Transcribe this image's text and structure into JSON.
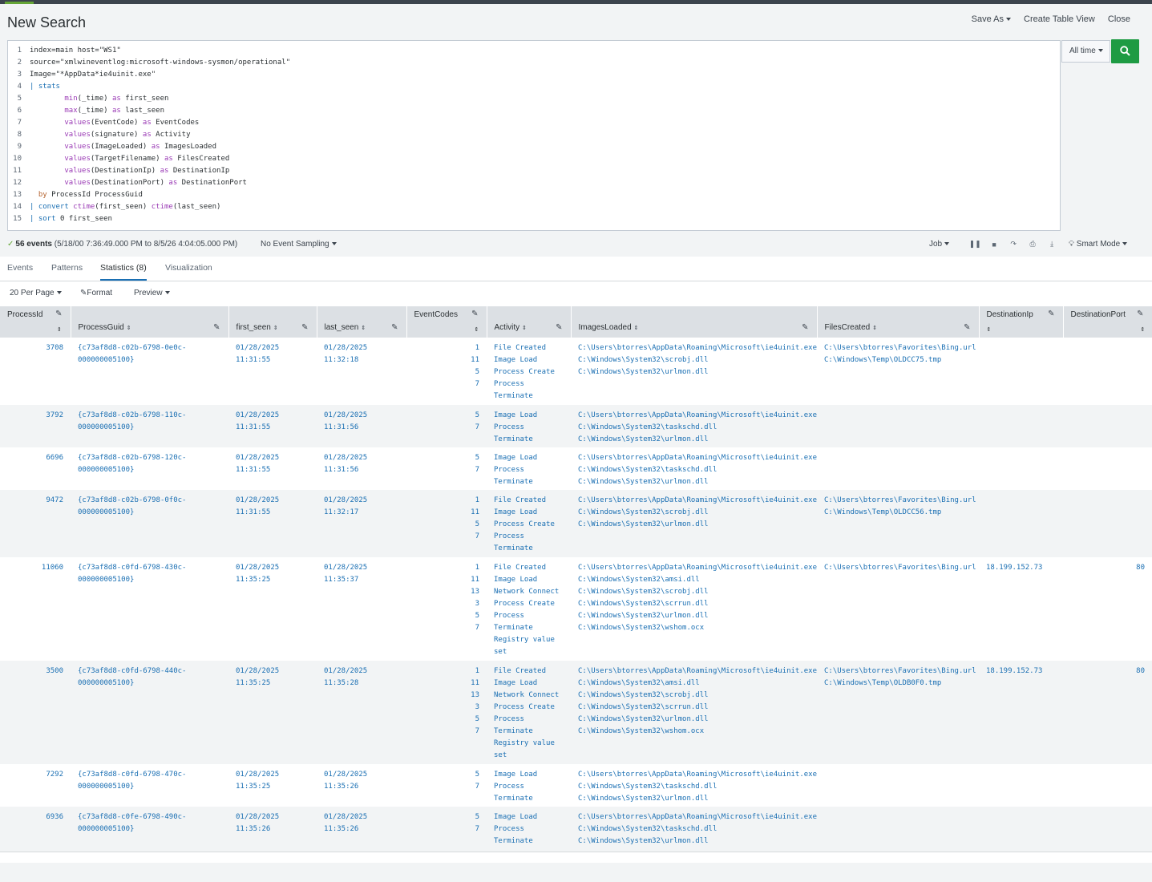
{
  "header": {
    "title": "New Search",
    "save_as": "Save As",
    "create_table_view": "Create Table View",
    "close": "Close"
  },
  "editor": {
    "lines": [
      {
        "n": "1",
        "parts": [
          [
            "",
            "index=main host=\"WS1\""
          ]
        ]
      },
      {
        "n": "2",
        "parts": [
          [
            "",
            "source=\"xmlwineventlog:microsoft-windows-sysmon/operational\""
          ]
        ]
      },
      {
        "n": "3",
        "parts": [
          [
            "",
            "Image=\"*AppData*ie4uinit.exe\""
          ]
        ]
      },
      {
        "n": "4",
        "parts": [
          [
            "pipe",
            "| "
          ],
          [
            "cmd",
            "stats"
          ]
        ]
      },
      {
        "n": "5",
        "parts": [
          [
            "",
            "        "
          ],
          [
            "kw",
            "min"
          ],
          [
            "",
            "(_time) "
          ],
          [
            "kw",
            "as"
          ],
          [
            "",
            " first_seen"
          ]
        ]
      },
      {
        "n": "6",
        "parts": [
          [
            "",
            "        "
          ],
          [
            "kw",
            "max"
          ],
          [
            "",
            "(_time) "
          ],
          [
            "kw",
            "as"
          ],
          [
            "",
            " last_seen"
          ]
        ]
      },
      {
        "n": "7",
        "parts": [
          [
            "",
            "        "
          ],
          [
            "kw",
            "values"
          ],
          [
            "",
            "(EventCode) "
          ],
          [
            "kw",
            "as"
          ],
          [
            "",
            " EventCodes"
          ]
        ]
      },
      {
        "n": "8",
        "parts": [
          [
            "",
            "        "
          ],
          [
            "kw",
            "values"
          ],
          [
            "",
            "(signature) "
          ],
          [
            "kw",
            "as"
          ],
          [
            "",
            " Activity"
          ]
        ]
      },
      {
        "n": "9",
        "parts": [
          [
            "",
            "        "
          ],
          [
            "kw",
            "values"
          ],
          [
            "",
            "(ImageLoaded) "
          ],
          [
            "kw",
            "as"
          ],
          [
            "",
            " ImagesLoaded"
          ]
        ]
      },
      {
        "n": "10",
        "parts": [
          [
            "",
            "        "
          ],
          [
            "kw",
            "values"
          ],
          [
            "",
            "(TargetFilename) "
          ],
          [
            "kw",
            "as"
          ],
          [
            "",
            " FilesCreated"
          ]
        ]
      },
      {
        "n": "11",
        "parts": [
          [
            "",
            "        "
          ],
          [
            "kw",
            "values"
          ],
          [
            "",
            "(DestinationIp) "
          ],
          [
            "kw",
            "as"
          ],
          [
            "",
            " DestinationIp"
          ]
        ]
      },
      {
        "n": "12",
        "parts": [
          [
            "",
            "        "
          ],
          [
            "kw",
            "values"
          ],
          [
            "",
            "(DestinationPort) "
          ],
          [
            "kw",
            "as"
          ],
          [
            "",
            " DestinationPort"
          ]
        ]
      },
      {
        "n": "13",
        "parts": [
          [
            "",
            "  "
          ],
          [
            "by",
            "by"
          ],
          [
            "",
            " ProcessId ProcessGuid"
          ]
        ]
      },
      {
        "n": "14",
        "parts": [
          [
            "pipe",
            "| "
          ],
          [
            "cmd",
            "convert"
          ],
          [
            "",
            " "
          ],
          [
            "kw",
            "ctime"
          ],
          [
            "",
            "(first_seen) "
          ],
          [
            "kw",
            "ctime"
          ],
          [
            "",
            "(last_seen)"
          ]
        ]
      },
      {
        "n": "15",
        "parts": [
          [
            "pipe",
            "| "
          ],
          [
            "cmd",
            "sort"
          ],
          [
            "",
            " 0 first_seen"
          ]
        ]
      }
    ]
  },
  "time_picker": "All time",
  "status": {
    "events_count": "56 events",
    "range": "(5/18/00 7:36:49.000 PM to 8/5/26 4:04:05.000 PM)",
    "sampling": "No Event Sampling",
    "job": "Job",
    "mode": "Smart Mode"
  },
  "tabs": [
    "Events",
    "Patterns",
    "Statistics (8)",
    "Visualization"
  ],
  "table_toolbar": {
    "per_page": "20 Per Page",
    "format": "Format",
    "preview": "Preview"
  },
  "columns": [
    "ProcessId",
    "ProcessGuid",
    "first_seen",
    "last_seen",
    "EventCodes",
    "Activity",
    "ImagesLoaded",
    "FilesCreated",
    "DestinationIp",
    "DestinationPort"
  ],
  "rows": [
    {
      "ProcessId": "3708",
      "ProcessGuid": "{c73af8d8-c02b-6798-0e0c-\n000000005100}",
      "first_seen": "01/28/2025\n11:31:55",
      "last_seen": "01/28/2025\n11:32:18",
      "EventCodes": "1\n11\n5\n7",
      "Activity": "File Created\nImage Load\nProcess Create\nProcess\nTerminate",
      "ImagesLoaded": "C:\\Users\\btorres\\AppData\\Roaming\\Microsoft\\ie4uinit.exe\nC:\\Windows\\System32\\scrobj.dll\nC:\\Windows\\System32\\urlmon.dll",
      "FilesCreated": "C:\\Users\\btorres\\Favorites\\Bing.url\nC:\\Windows\\Temp\\OLDCC75.tmp",
      "DestinationIp": "",
      "DestinationPort": ""
    },
    {
      "ProcessId": "3792",
      "ProcessGuid": "{c73af8d8-c02b-6798-110c-\n000000005100}",
      "first_seen": "01/28/2025\n11:31:55",
      "last_seen": "01/28/2025\n11:31:56",
      "EventCodes": "5\n7",
      "Activity": "Image Load\nProcess\nTerminate",
      "ImagesLoaded": "C:\\Users\\btorres\\AppData\\Roaming\\Microsoft\\ie4uinit.exe\nC:\\Windows\\System32\\taskschd.dll\nC:\\Windows\\System32\\urlmon.dll",
      "FilesCreated": "",
      "DestinationIp": "",
      "DestinationPort": ""
    },
    {
      "ProcessId": "6696",
      "ProcessGuid": "{c73af8d8-c02b-6798-120c-\n000000005100}",
      "first_seen": "01/28/2025\n11:31:55",
      "last_seen": "01/28/2025\n11:31:56",
      "EventCodes": "5\n7",
      "Activity": "Image Load\nProcess\nTerminate",
      "ImagesLoaded": "C:\\Users\\btorres\\AppData\\Roaming\\Microsoft\\ie4uinit.exe\nC:\\Windows\\System32\\taskschd.dll\nC:\\Windows\\System32\\urlmon.dll",
      "FilesCreated": "",
      "DestinationIp": "",
      "DestinationPort": ""
    },
    {
      "ProcessId": "9472",
      "ProcessGuid": "{c73af8d8-c02b-6798-0f0c-\n000000005100}",
      "first_seen": "01/28/2025\n11:31:55",
      "last_seen": "01/28/2025\n11:32:17",
      "EventCodes": "1\n11\n5\n7",
      "Activity": "File Created\nImage Load\nProcess Create\nProcess\nTerminate",
      "ImagesLoaded": "C:\\Users\\btorres\\AppData\\Roaming\\Microsoft\\ie4uinit.exe\nC:\\Windows\\System32\\scrobj.dll\nC:\\Windows\\System32\\urlmon.dll",
      "FilesCreated": "C:\\Users\\btorres\\Favorites\\Bing.url\nC:\\Windows\\Temp\\OLDCC56.tmp",
      "DestinationIp": "",
      "DestinationPort": ""
    },
    {
      "ProcessId": "11060",
      "ProcessGuid": "{c73af8d8-c0fd-6798-430c-\n000000005100}",
      "first_seen": "01/28/2025\n11:35:25",
      "last_seen": "01/28/2025\n11:35:37",
      "EventCodes": "1\n11\n13\n3\n5\n7",
      "Activity": "File Created\nImage Load\nNetwork Connect\nProcess Create\nProcess\nTerminate\nRegistry value\nset",
      "ImagesLoaded": "C:\\Users\\btorres\\AppData\\Roaming\\Microsoft\\ie4uinit.exe\nC:\\Windows\\System32\\amsi.dll\nC:\\Windows\\System32\\scrobj.dll\nC:\\Windows\\System32\\scrrun.dll\nC:\\Windows\\System32\\urlmon.dll\nC:\\Windows\\System32\\wshom.ocx",
      "FilesCreated": "C:\\Users\\btorres\\Favorites\\Bing.url",
      "DestinationIp": "18.199.152.73",
      "DestinationPort": "80"
    },
    {
      "ProcessId": "3500",
      "ProcessGuid": "{c73af8d8-c0fd-6798-440c-\n000000005100}",
      "first_seen": "01/28/2025\n11:35:25",
      "last_seen": "01/28/2025\n11:35:28",
      "EventCodes": "1\n11\n13\n3\n5\n7",
      "Activity": "File Created\nImage Load\nNetwork Connect\nProcess Create\nProcess\nTerminate\nRegistry value\nset",
      "ImagesLoaded": "C:\\Users\\btorres\\AppData\\Roaming\\Microsoft\\ie4uinit.exe\nC:\\Windows\\System32\\amsi.dll\nC:\\Windows\\System32\\scrobj.dll\nC:\\Windows\\System32\\scrrun.dll\nC:\\Windows\\System32\\urlmon.dll\nC:\\Windows\\System32\\wshom.ocx",
      "FilesCreated": "C:\\Users\\btorres\\Favorites\\Bing.url\nC:\\Windows\\Temp\\OLDB0F0.tmp",
      "DestinationIp": "18.199.152.73",
      "DestinationPort": "80"
    },
    {
      "ProcessId": "7292",
      "ProcessGuid": "{c73af8d8-c0fd-6798-470c-\n000000005100}",
      "first_seen": "01/28/2025\n11:35:25",
      "last_seen": "01/28/2025\n11:35:26",
      "EventCodes": "5\n7",
      "Activity": "Image Load\nProcess\nTerminate",
      "ImagesLoaded": "C:\\Users\\btorres\\AppData\\Roaming\\Microsoft\\ie4uinit.exe\nC:\\Windows\\System32\\taskschd.dll\nC:\\Windows\\System32\\urlmon.dll",
      "FilesCreated": "",
      "DestinationIp": "",
      "DestinationPort": ""
    },
    {
      "ProcessId": "6936",
      "ProcessGuid": "{c73af8d8-c0fe-6798-490c-\n000000005100}",
      "first_seen": "01/28/2025\n11:35:26",
      "last_seen": "01/28/2025\n11:35:26",
      "EventCodes": "5\n7",
      "Activity": "Image Load\nProcess\nTerminate",
      "ImagesLoaded": "C:\\Users\\btorres\\AppData\\Roaming\\Microsoft\\ie4uinit.exe\nC:\\Windows\\System32\\taskschd.dll\nC:\\Windows\\System32\\urlmon.dll",
      "FilesCreated": "",
      "DestinationIp": "",
      "DestinationPort": ""
    }
  ]
}
